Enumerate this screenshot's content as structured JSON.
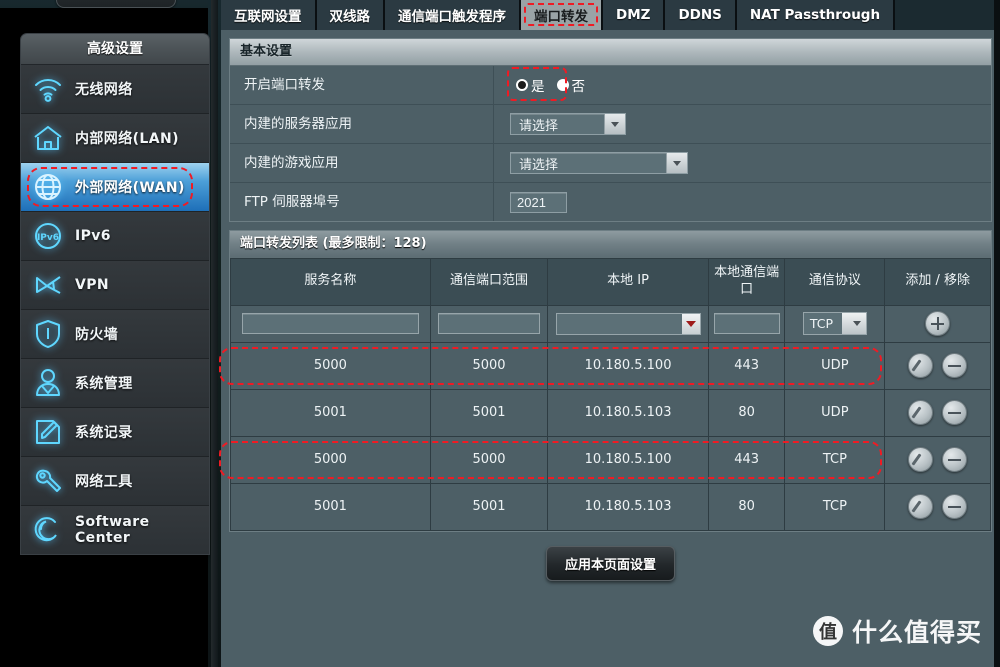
{
  "sidebar": {
    "header": "高级设置",
    "items": [
      {
        "label": "无线网络",
        "icon": "wifi-icon",
        "active": false
      },
      {
        "label": "内部网络(LAN)",
        "icon": "home-icon",
        "active": false
      },
      {
        "label": "外部网络(WAN)",
        "icon": "globe-icon",
        "active": true
      },
      {
        "label": "IPv6",
        "icon": "ipv6-icon",
        "active": false
      },
      {
        "label": "VPN",
        "icon": "vpn-icon",
        "active": false
      },
      {
        "label": "防火墙",
        "icon": "shield-icon",
        "active": false
      },
      {
        "label": "系统管理",
        "icon": "user-icon",
        "active": false
      },
      {
        "label": "系统记录",
        "icon": "notepad-icon",
        "active": false
      },
      {
        "label": "网络工具",
        "icon": "wrench-icon",
        "active": false
      },
      {
        "label": "Software Center",
        "icon": "debian-swirl-icon",
        "active": false
      }
    ]
  },
  "tabs": [
    {
      "label": "互联网设置",
      "active": false
    },
    {
      "label": "双线路",
      "active": false
    },
    {
      "label": "通信端口触发程序",
      "active": false
    },
    {
      "label": "端口转发",
      "active": true
    },
    {
      "label": "DMZ",
      "active": false
    },
    {
      "label": "DDNS",
      "active": false
    },
    {
      "label": "NAT Passthrough",
      "active": false
    }
  ],
  "basic": {
    "title": "基本设置",
    "rows": {
      "enable_label": "开启端口转发",
      "radio_yes": "是",
      "radio_no": "否",
      "server_app_label": "内建的服务器应用",
      "server_app_value": "请选择",
      "game_app_label": "内建的游戏应用",
      "game_app_value": "请选择",
      "ftp_port_label": "FTP 伺服器埠号",
      "ftp_port_value": "2021"
    }
  },
  "list": {
    "title": "端口转发列表 (最多限制：128)",
    "columns": [
      "服务名称",
      "通信端口范围",
      "本地 IP",
      "本地通信端口",
      "通信协议",
      "添加 / 移除"
    ],
    "new_row": {
      "service_name": "",
      "port_range": "",
      "local_ip": "",
      "local_port": "",
      "protocol": "TCP",
      "add_icon": "plus-circle-icon"
    },
    "rows": [
      {
        "service_name": "5000",
        "port_range": "5000",
        "local_ip": "10.180.5.100",
        "local_port": "443",
        "protocol": "UDP",
        "highlighted": true
      },
      {
        "service_name": "5001",
        "port_range": "5001",
        "local_ip": "10.180.5.103",
        "local_port": "80",
        "protocol": "UDP",
        "highlighted": false
      },
      {
        "service_name": "5000",
        "port_range": "5000",
        "local_ip": "10.180.5.100",
        "local_port": "443",
        "protocol": "TCP",
        "highlighted": true
      },
      {
        "service_name": "5001",
        "port_range": "5001",
        "local_ip": "10.180.5.103",
        "local_port": "80",
        "protocol": "TCP",
        "highlighted": false
      }
    ],
    "row_icons": {
      "edit": "pencil-circle-icon",
      "remove": "minus-circle-icon"
    }
  },
  "apply_button": "应用本页面设置",
  "watermark": {
    "badge": "值",
    "text": "什么值得买"
  },
  "colors": {
    "accent_blue": "#5fd7ff",
    "highlight_red": "#ef1b24",
    "panel_bg": "#4d5f66",
    "header_bg": "#3b4d54",
    "sidebar_active": "#1e6fb8"
  }
}
